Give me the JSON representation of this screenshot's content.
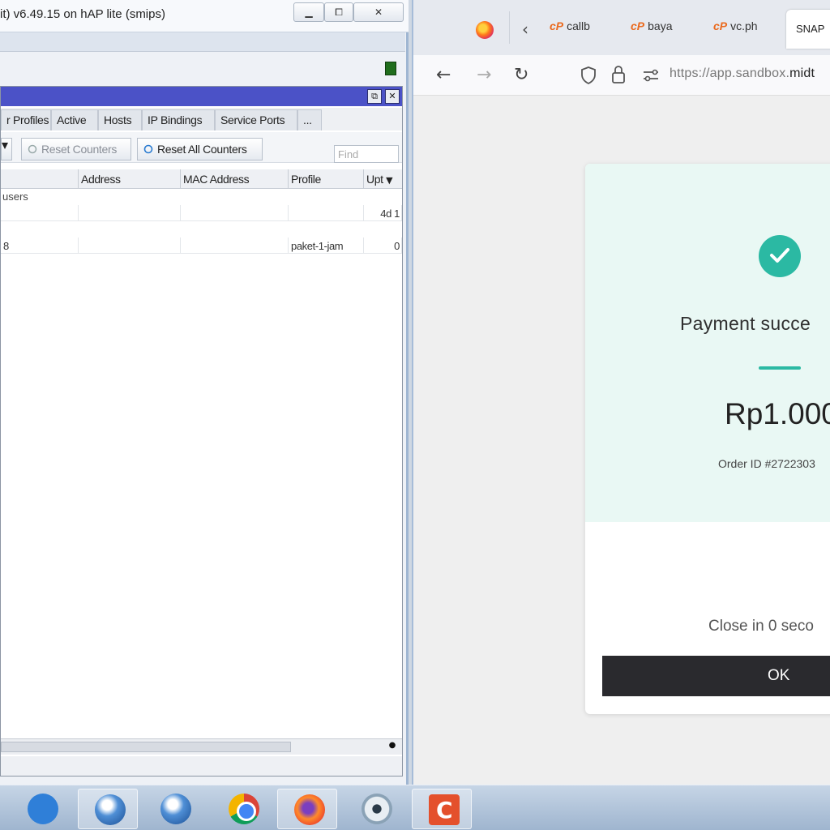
{
  "winbox": {
    "title": "it) v6.49.15 on hAP lite (smips)",
    "window_controls": {
      "minimize": "▁",
      "maximize": "⧠",
      "close": "✕"
    },
    "inner_controls": {
      "restore": "⧉",
      "close": "✕"
    },
    "tabs": [
      "r Profiles",
      "Active",
      "Hosts",
      "IP Bindings",
      "Service Ports",
      "..."
    ],
    "toolbar": {
      "filter_icon": "filter-icon",
      "reset_counters": "Reset Counters",
      "reset_all_counters": "Reset All Counters",
      "find_placeholder": "Find"
    },
    "columns": [
      "Address",
      "MAC Address",
      "Profile",
      "Upt"
    ],
    "groups": [
      {
        "label": "users"
      }
    ],
    "rows": [
      {
        "name": "",
        "address": "",
        "mac": "",
        "profile": "",
        "uptime": "4d 1"
      },
      {
        "name": "8",
        "address": "",
        "mac": "",
        "profile": "paket-1-jam",
        "uptime": "0"
      }
    ]
  },
  "browser": {
    "tabs": [
      {
        "label": "callb"
      },
      {
        "label": "baya"
      },
      {
        "label": "vc.ph"
      },
      {
        "label": "SNAP"
      }
    ],
    "url_prefix": "https://app.sandbox.",
    "url_domain": "midt",
    "payment": {
      "title": "Payment succe",
      "amount": "Rp1.000",
      "order_id": "Order ID #2722303",
      "close_text": "Close in 0 seco",
      "ok_label": "OK",
      "accent": "#2bb9a3"
    }
  },
  "taskbar": {
    "items": [
      "desktop-icon",
      "winbox-icon",
      "winbox-icon",
      "chrome-icon",
      "firefox-icon",
      "camera-icon",
      "recorder-icon"
    ]
  }
}
